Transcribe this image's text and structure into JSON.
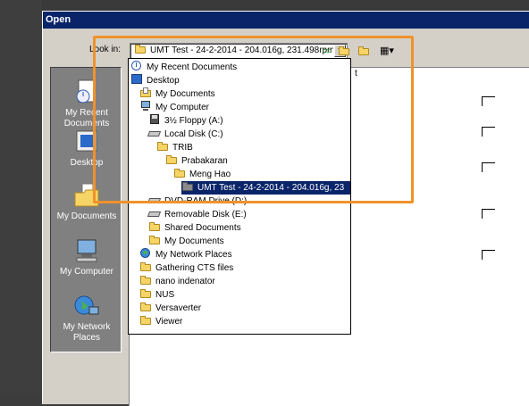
{
  "dialog": {
    "title": "Open",
    "look_in_label": "Look in:",
    "look_in_value": "UMT Test - 24-2-2014 - 204.016g, 231.498rpm"
  },
  "places": [
    {
      "label": "My Recent Documents",
      "icon": "recent-documents-icon"
    },
    {
      "label": "Desktop",
      "icon": "desktop-icon"
    },
    {
      "label": "My Documents",
      "icon": "my-documents-icon"
    },
    {
      "label": "My Computer",
      "icon": "my-computer-icon"
    },
    {
      "label": "My Network Places",
      "icon": "network-places-icon"
    }
  ],
  "dropdown": {
    "items": [
      {
        "label": "My Recent Documents",
        "icon": "recent-icon"
      },
      {
        "label": "Desktop",
        "icon": "desktop-icon"
      },
      {
        "label": "My Documents",
        "icon": "folder-icon"
      },
      {
        "label": "My Computer",
        "icon": "computer-icon"
      },
      {
        "label": "3½ Floppy (A:)",
        "icon": "floppy-icon"
      },
      {
        "label": "Local Disk (C:)",
        "icon": "drive-icon"
      },
      {
        "label": "TRIB",
        "icon": "folder-icon"
      },
      {
        "label": "Prabakaran",
        "icon": "folder-icon"
      },
      {
        "label": "Meng Hao",
        "icon": "folder-icon"
      },
      {
        "label": "UMT Test - 24-2-2014 - 204.016g, 23",
        "icon": "folder-icon",
        "selected": true
      },
      {
        "label": "DVD-RAM Drive (D:)",
        "icon": "drive-icon"
      },
      {
        "label": "Removable Disk (E:)",
        "icon": "drive-icon"
      },
      {
        "label": "Shared Documents",
        "icon": "folder-icon"
      },
      {
        "label": "My Documents",
        "icon": "folder-icon"
      },
      {
        "label": "My Network Places",
        "icon": "globe-icon"
      },
      {
        "label": "Gathering CTS files",
        "icon": "folder-icon"
      },
      {
        "label": "nano indenator",
        "icon": "folder-icon"
      },
      {
        "label": "NUS",
        "icon": "folder-icon"
      },
      {
        "label": "Versaverter",
        "icon": "folder-icon"
      },
      {
        "label": "Viewer",
        "icon": "folder-icon"
      }
    ]
  },
  "file_pane": {
    "visible_fragment": "t"
  },
  "colors": {
    "titlebar": "#0a246a",
    "highlight": "#f0922b",
    "selection": "#0a246a"
  }
}
